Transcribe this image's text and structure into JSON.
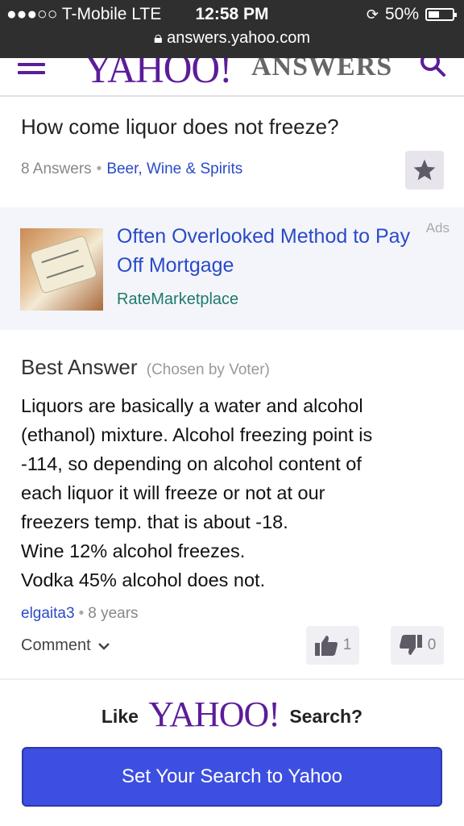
{
  "status_bar": {
    "signal": "●●●○○",
    "carrier": "T-Mobile",
    "network": "LTE",
    "time": "12:58 PM",
    "battery": "50%",
    "battery_level": 0.5,
    "url": "answers.yahoo.com"
  },
  "header": {
    "logo_yahoo": "YAHOO!",
    "logo_answers": "ANSWERS",
    "accent_color": "#5b1d99"
  },
  "question": {
    "title": "How come liquor does not freeze?",
    "answers_count": "8 Answers",
    "separator": "•",
    "category": "Beer, Wine & Spirits"
  },
  "ad": {
    "label": "Ads",
    "title": "Often Overlooked Method to Pay Off Mortgage",
    "source": "RateMarketplace"
  },
  "best_answer": {
    "heading": "Best Answer",
    "chosen": "(Chosen by Voter)",
    "lines": [
      "Liquors are basically a water and alcohol",
      "(ethanol) mixture. Alcohol freezing point is",
      "-114, so depending on alcohol content of",
      "each liquor it will freeze or not at our",
      "freezers temp. that is about -18.",
      "Wine 12% alcohol freezes.",
      "Vodka 45% alcohol does not."
    ],
    "user": "elgaita3",
    "separator": "•",
    "age": "8 years",
    "comment_label": "Comment",
    "thumbs_up": "1",
    "thumbs_down": "0"
  },
  "promo": {
    "like": "Like",
    "logo": "YAHOO!",
    "search": "Search?",
    "cta": "Set Your Search to Yahoo",
    "cta_color": "#3d4fe0"
  }
}
